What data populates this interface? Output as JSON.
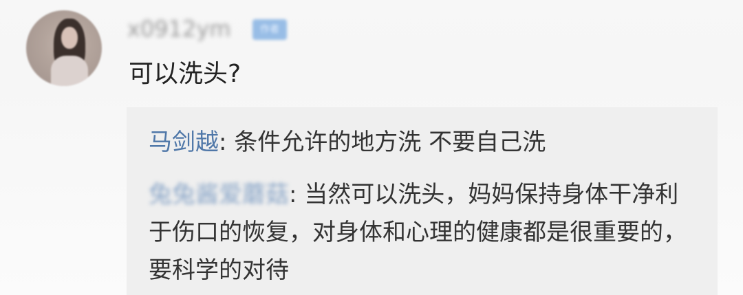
{
  "comment": {
    "username": "x0912ym",
    "badge": "作者",
    "text": "可以洗头?"
  },
  "replies": [
    {
      "author": "马剑越",
      "separator": ":",
      "text": " 条件允许的地方洗 不要自己洗"
    },
    {
      "author": "兔兔酱爱蘑菇",
      "separator": ":",
      "text": " 当然可以洗头，妈妈保持身体干净利于伤口的恢复，对身体和心理的健康都是很重要的，要科学的对待"
    }
  ],
  "colors": {
    "background": "#f7f7f7",
    "reply_box": "#efefef",
    "author_link": "#4f77a8",
    "text": "#222222",
    "badge": "#98bde6"
  }
}
